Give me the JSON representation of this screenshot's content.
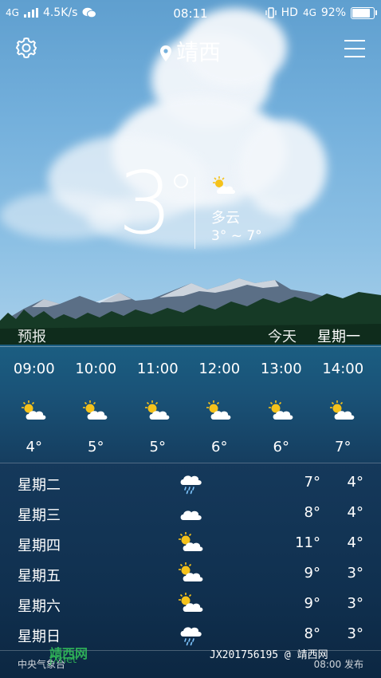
{
  "status_bar": {
    "network": "4G",
    "speed": "4.5K/s",
    "time": "08:11",
    "hd": "HD",
    "net2": "4G",
    "battery": "92%",
    "battery_level": 0.92
  },
  "header": {
    "city": "靖西",
    "settings_icon": "gear-icon",
    "menu_icon": "menu-icon",
    "location_icon": "location-pin-icon"
  },
  "current": {
    "temp": "3",
    "condition": "多云",
    "range": "3° ~ 7°",
    "icon": "partly-cloudy-icon"
  },
  "forecast": {
    "label": "预报",
    "today": "今天",
    "weekday": "星期一"
  },
  "hourly": [
    {
      "time": "09:00",
      "temp": "4°",
      "icon": "partly-cloudy-icon"
    },
    {
      "time": "10:00",
      "temp": "5°",
      "icon": "partly-cloudy-icon"
    },
    {
      "time": "11:00",
      "temp": "5°",
      "icon": "partly-cloudy-icon"
    },
    {
      "time": "12:00",
      "temp": "6°",
      "icon": "partly-cloudy-icon"
    },
    {
      "time": "13:00",
      "temp": "6°",
      "icon": "partly-cloudy-icon"
    },
    {
      "time": "14:00",
      "temp": "7°",
      "icon": "partly-cloudy-icon"
    }
  ],
  "daily": [
    {
      "day": "星期二",
      "high": "7°",
      "low": "4°",
      "icon": "rain-icon"
    },
    {
      "day": "星期三",
      "high": "8°",
      "low": "4°",
      "icon": "cloudy-icon"
    },
    {
      "day": "星期四",
      "high": "11°",
      "low": "4°",
      "icon": "partly-cloudy-icon"
    },
    {
      "day": "星期五",
      "high": "9°",
      "low": "3°",
      "icon": "partly-cloudy-icon"
    },
    {
      "day": "星期六",
      "high": "9°",
      "low": "3°",
      "icon": "partly-cloudy-icon"
    },
    {
      "day": "星期日",
      "high": "8°",
      "low": "3°",
      "icon": "rain-icon"
    }
  ],
  "footer": {
    "source": "中央气象台",
    "watermark": "JX201756195 @ 靖西网",
    "watermark_site": "靖西网",
    "watermark_url": "JXnet",
    "published": "08:00 发布"
  },
  "colors": {
    "sky": "#74b0dc",
    "water": "#1a5378",
    "panel": "#10304f",
    "sun": "#f5c21b",
    "cloud": "#ffffff"
  }
}
